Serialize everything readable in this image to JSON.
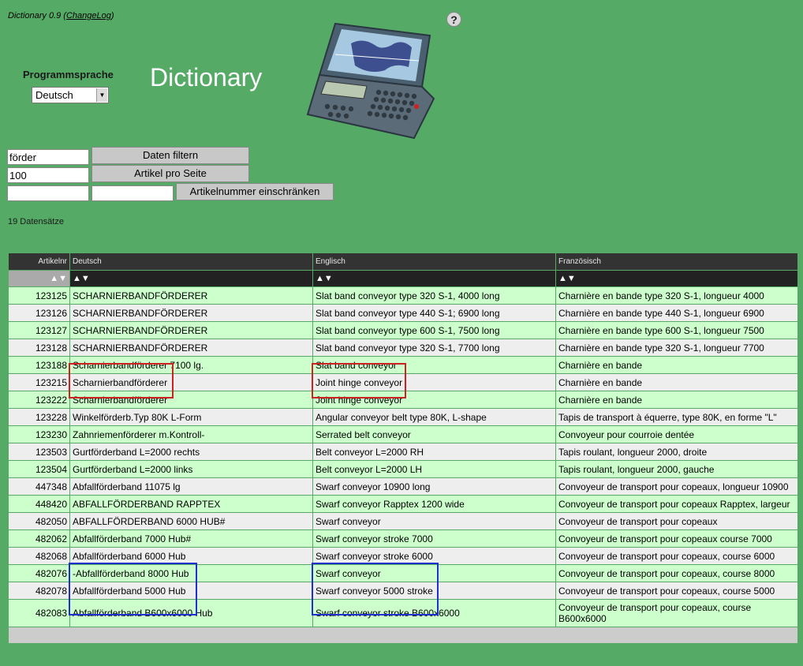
{
  "header": {
    "version": "Dictionary 0.9 (",
    "changelog": "ChangeLog",
    "version_close": ")",
    "title": "Dictionary",
    "help": "?"
  },
  "language": {
    "label": "Programmsprache",
    "selected": "Deutsch"
  },
  "filters": {
    "search_value": "förder",
    "filter_button": "Daten filtern",
    "per_page_value": "100",
    "per_page_button": "Artikel pro Seite",
    "range_from": "",
    "range_to": "",
    "range_button": "Artikelnummer einschränken"
  },
  "record_count": "19 Datensätze",
  "table": {
    "columns": [
      "Artikelnr",
      "Deutsch",
      "Englisch",
      "Französisch"
    ],
    "sort": "▲▼",
    "rows": [
      [
        "123125",
        "SCHARNIERBANDFÖRDERER",
        "Slat band conveyor type 320 S-1, 4000 long",
        "Charnière en bande type 320 S-1, longueur 4000"
      ],
      [
        "123126",
        "SCHARNIERBANDFÖRDERER",
        "Slat band conveyor type 440 S-1; 6900 long",
        "Charnière en bande type 440 S-1, longueur 6900"
      ],
      [
        "123127",
        "SCHARNIERBANDFÖRDERER",
        "Slat band conveyor type 600 S-1, 7500 long",
        "Charnière en bande type 600 S-1, longueur 7500"
      ],
      [
        "123128",
        "SCHARNIERBANDFÖRDERER",
        "Slat band conveyor type 320 S-1, 7700 long",
        "Charnière en bande type 320 S-1, longueur 7700"
      ],
      [
        "123188",
        "Scharnierbandförderer 7100 lg.",
        "Slat band conveyor",
        "Charnière en bande"
      ],
      [
        "123215",
        "Scharnierbandförderer",
        "Joint hinge conveyor",
        "Charnière en bande"
      ],
      [
        "123222",
        "Scharnierbandförderer",
        "Joint hinge conveyor",
        "Charnière en bande"
      ],
      [
        "123228",
        "Winkelförderb.Typ 80K L-Form",
        "Angular conveyor belt type 80K, L-shape",
        "Tapis de transport à équerre, type 80K, en forme \"L\""
      ],
      [
        "123230",
        "Zahnriemenförderer m.Kontroll-",
        "Serrated belt conveyor",
        "Convoyeur pour courroie dentée"
      ],
      [
        "123503",
        "Gurtförderband L=2000 rechts",
        "Belt conveyor L=2000 RH",
        "Tapis roulant, longueur 2000, droite"
      ],
      [
        "123504",
        "Gurtförderband L=2000 links",
        "Belt conveyor L=2000 LH",
        "Tapis roulant, longueur 2000, gauche"
      ],
      [
        "447348",
        "Abfallförderband 11075 lg",
        "Swarf conveyor 10900 long",
        "Convoyeur de transport pour copeaux, longueur 10900"
      ],
      [
        "448420",
        "ABFALLFÖRDERBAND RAPPTEX",
        "Swarf conveyor Rapptex 1200 wide",
        "Convoyeur de transport pour copeaux Rapptex, largeur"
      ],
      [
        "482050",
        "ABFALLFÖRDERBAND 6000 HUB#",
        "Swarf conveyor",
        "Convoyeur de transport pour copeaux"
      ],
      [
        "482062",
        "Abfallförderband 7000 Hub#",
        "Swarf conveyor stroke 7000",
        "Convoyeur de transport pour copeaux course 7000"
      ],
      [
        "482068",
        "Abfallförderband 6000 Hub",
        "Swarf conveyor stroke 6000",
        "Convoyeur de transport pour copeaux, course 6000"
      ],
      [
        "482076",
        "-Abfallförderband 8000 Hub",
        "Swarf conveyor",
        "Convoyeur de transport pour copeaux, course 8000"
      ],
      [
        "482078",
        "Abfallförderband 5000 Hub",
        "Swarf conveyor 5000 stroke",
        "Convoyeur de transport pour copeaux, course 5000"
      ],
      [
        "482083",
        "Abfallförderband B600x6000 Hub",
        "Swarf conveyor stroke B600x6000",
        "Convoyeur de transport pour copeaux, course B600x6000"
      ]
    ]
  },
  "colors": {
    "background": "#55aa66",
    "highlight_red": "#cc2222",
    "highlight_blue": "#1f2fd0"
  }
}
